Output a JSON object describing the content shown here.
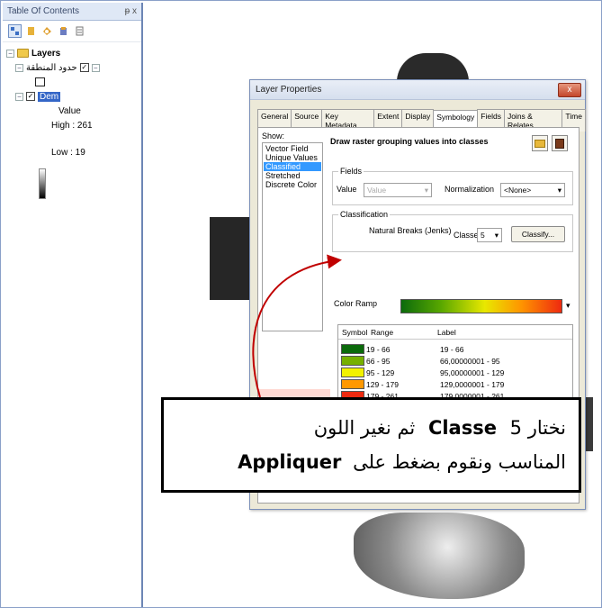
{
  "toc": {
    "title": "Table Of Contents",
    "pin": "ᵽ x",
    "root_label": "Layers",
    "layer1_label": "حدود المنطقة",
    "layer2_label": "Dem",
    "legend_field": "Value",
    "legend_high": "High : 261",
    "legend_low": "Low : 19"
  },
  "dialog": {
    "title": "Layer Properties",
    "close": "x",
    "tabs": [
      "General",
      "Source",
      "Key Metadata",
      "Extent",
      "Display",
      "Symbology",
      "Fields",
      "Joins & Relates",
      "Time"
    ],
    "active_tab": "Symbology",
    "show_label": "Show:",
    "show_items": [
      "Vector Field",
      "Unique Values",
      "Classified",
      "Stretched",
      "Discrete Color"
    ],
    "selected_show": "Classified",
    "description": "Draw raster grouping values into classes",
    "fields_title": "Fields",
    "value_label": "Value",
    "value_field": "Value",
    "normalization_label": "Normalization",
    "normalization_value": "<None>",
    "classification_title": "Classification",
    "method": "Natural Breaks (Jenks)",
    "classes_label": "Classes",
    "classes_value": "5",
    "classify_button": "Classify...",
    "color_ramp_label": "Color Ramp",
    "columns": [
      "Symbol",
      "Range",
      "Label"
    ],
    "classes": [
      {
        "range": "19 - 66",
        "label": "19 - 66",
        "color": "#0b6a0b"
      },
      {
        "range": "66 - 95",
        "label": "66,00000001 - 95",
        "color": "#76b000"
      },
      {
        "range": "95 - 129",
        "label": "95,00000001 - 129",
        "color": "#f2f200"
      },
      {
        "range": "129 - 179",
        "label": "129,0000001 - 179",
        "color": "#ff9800"
      },
      {
        "range": "179 - 261",
        "label": "179,0000001 - 261",
        "color": "#ee2a10"
      }
    ]
  },
  "callout": {
    "line1_a": "نختار",
    "line1_b": "Classe",
    "line1_c": "5 ثم نغير اللون",
    "line2_a": "المناسب ونقوم بضغط على",
    "line2_b": "Appliquer"
  }
}
